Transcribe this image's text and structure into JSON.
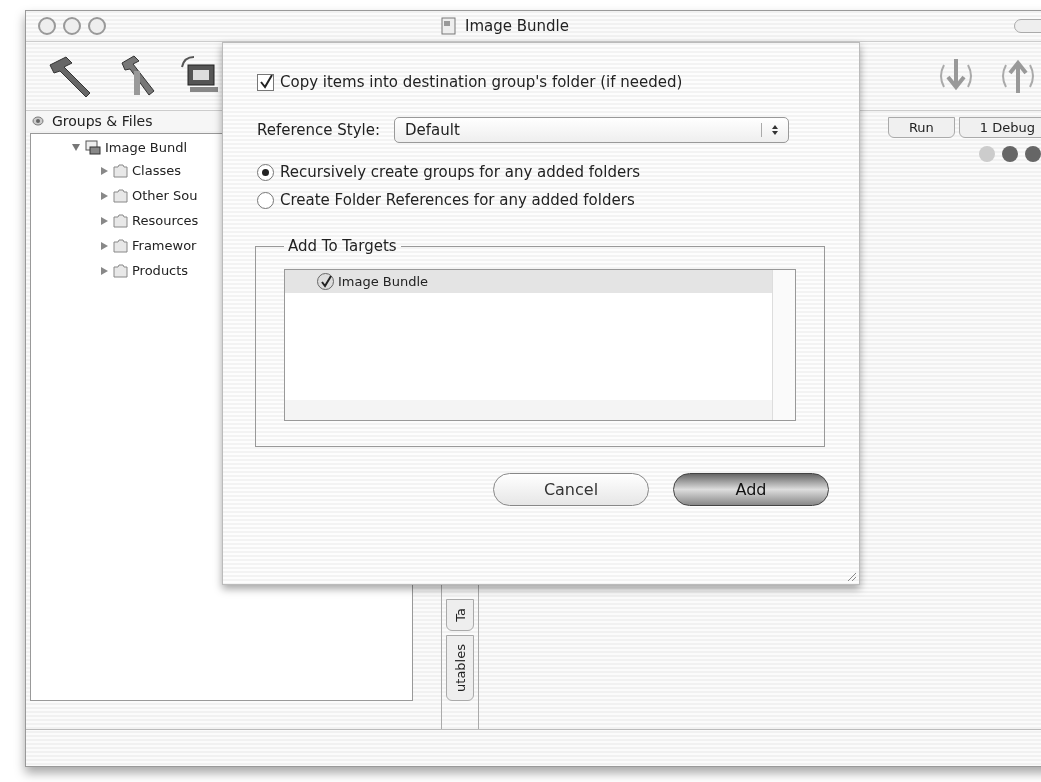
{
  "window": {
    "title": "Image Bundle"
  },
  "groups_panel": {
    "header": "Groups & Files",
    "tree": [
      {
        "label": "Image Bundl",
        "expanded": true,
        "children": [
          {
            "label": "Classes",
            "expanded": false
          },
          {
            "label": "Other Sou",
            "expanded": false
          },
          {
            "label": "Resources",
            "expanded": false
          },
          {
            "label": "Framewor",
            "expanded": false
          },
          {
            "label": "Products",
            "expanded": false
          }
        ]
      }
    ]
  },
  "side_tabs": [
    {
      "label": "Ta"
    },
    {
      "label": "utables"
    }
  ],
  "editor": {
    "tabs": [
      {
        "label": "Run"
      },
      {
        "label": "1 Debug"
      }
    ]
  },
  "sheet": {
    "copy_items": {
      "label": "Copy items into destination group's folder (if needed)",
      "checked": true
    },
    "reference_style": {
      "label": "Reference Style:",
      "value": "Default"
    },
    "options": [
      {
        "label": "Recursively create groups for any added folders",
        "selected": true
      },
      {
        "label": "Create Folder References for any added folders",
        "selected": false
      }
    ],
    "targets": {
      "title": "Add To Targets",
      "items": [
        {
          "label": "Image Bundle",
          "checked": true,
          "selected": true
        }
      ]
    },
    "buttons": [
      {
        "label": "Cancel",
        "default": false
      },
      {
        "label": "Add",
        "default": true
      }
    ]
  }
}
